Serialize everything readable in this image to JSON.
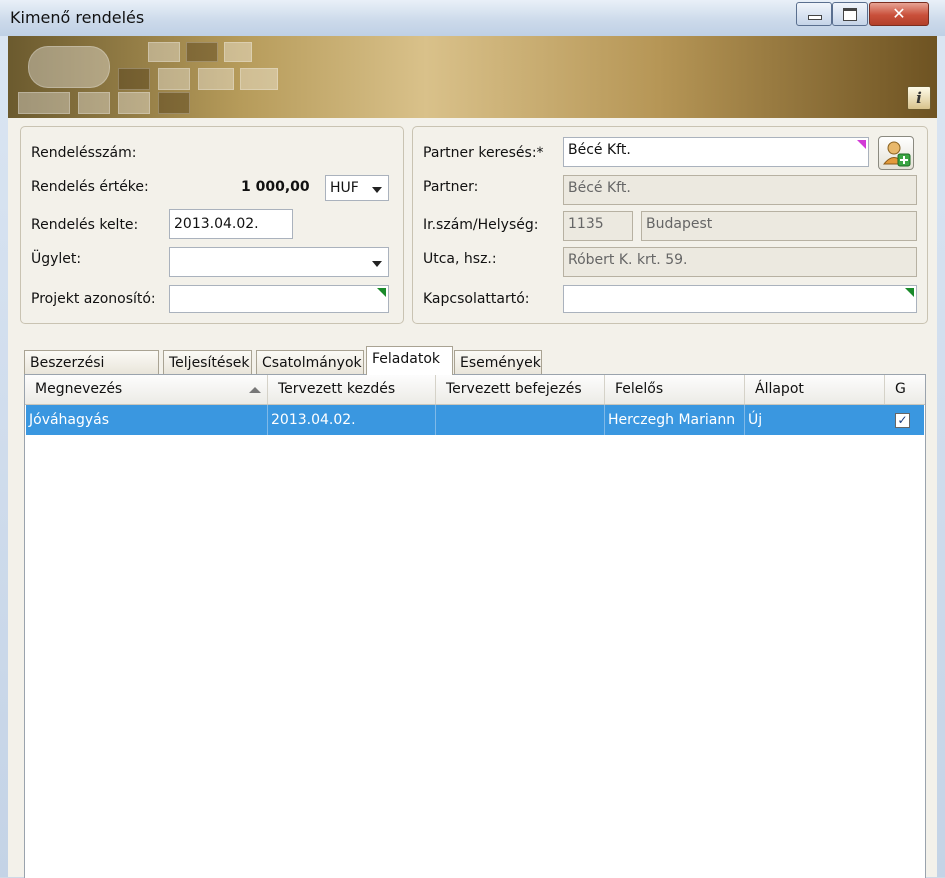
{
  "window": {
    "title": "Kimenő rendelés"
  },
  "order": {
    "number_label": "Rendelésszám:",
    "value_label": "Rendelés értéke:",
    "value": "1 000,00",
    "currency": "HUF",
    "date_label": "Rendelés kelte:",
    "date": "2013.04.02.",
    "deal_label": "Ügylet:",
    "deal": "",
    "project_label": "Projekt azonosító:",
    "project": ""
  },
  "partner": {
    "search_label": "Partner keresés:*",
    "search_value": "Bécé Kft.",
    "partner_label": "Partner:",
    "partner_value": "Bécé Kft.",
    "zip_city_label": "Ir.szám/Helység:",
    "zip": "1135",
    "city": "Budapest",
    "street_label": "Utca, hsz.:",
    "street": "Róbert K. krt. 59.",
    "contact_label": "Kapcsolattartó:",
    "contact": ""
  },
  "tabs": [
    "Beszerzési tételek",
    "Teljesítések",
    "Csatolmányok",
    "Feladatok",
    "Események"
  ],
  "active_tab": "Feladatok",
  "grid": {
    "columns": [
      "Megnevezés",
      "Tervezett kezdés",
      "Tervezett befejezés",
      "Felelős",
      "Állapot",
      "G"
    ],
    "rows": [
      {
        "name": "Jóváhagyás",
        "start": "2013.04.02.",
        "end": "",
        "owner": "Herczegh Mariann",
        "status": "Új",
        "g_checked": true
      }
    ]
  },
  "icons": {
    "info": "info-icon",
    "add_partner": "add-partner-icon",
    "minimize": "minimize-icon",
    "maximize": "maximize-icon",
    "close": "close-icon"
  },
  "colors": {
    "selection": "#3a97e0",
    "required_marker": "#d23bd6",
    "lookup_marker": "#1a8a2a"
  }
}
